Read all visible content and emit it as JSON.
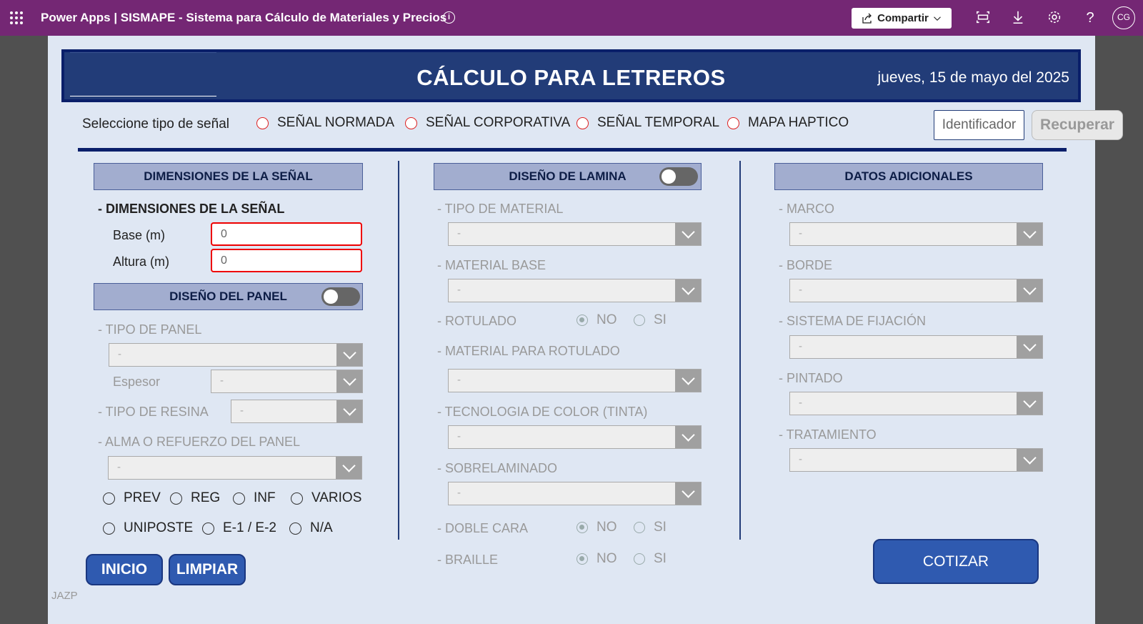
{
  "topbar": {
    "app_title": "Power Apps  |  SISMAPE - Sistema para Cálculo de Materiales y Precios",
    "share_label": "Compartir",
    "avatar_initials": "CG",
    "bg_color": "#742774"
  },
  "header": {
    "title": "CÁLCULO PARA LETREROS",
    "date": "jueves, 15 de mayo del 2025"
  },
  "signal_type": {
    "label": "Seleccione tipo de señal",
    "options": [
      "SEÑAL NORMADA",
      "SEÑAL CORPORATIVA",
      "SEÑAL TEMPORAL",
      "MAPA HAPTICO"
    ]
  },
  "identificador": {
    "placeholder": "Identificador"
  },
  "recuperar_label": "Recuperar",
  "dimensiones": {
    "heading": "DIMENSIONES DE LA SEÑAL",
    "subheading": "- DIMENSIONES DE LA SEÑAL",
    "base_label": "Base (m)",
    "base_value": "0",
    "altura_label": "Altura (m)",
    "altura_value": "0"
  },
  "panel": {
    "heading": "DISEÑO DEL PANEL",
    "tipo_panel": "- TIPO DE PANEL",
    "tipo_panel_value": "-",
    "espesor_label": "Espesor",
    "espesor_value": "-",
    "tipo_resina": "- TIPO DE RESINA",
    "tipo_resina_value": "-",
    "alma": "- ALMA O REFUERZO DEL PANEL",
    "alma_value": "-",
    "radios_row1": [
      "PREV",
      "REG",
      "INF",
      "VARIOS"
    ],
    "radios_row2": [
      "UNIPOSTE",
      "E-1 / E-2",
      "N/A"
    ]
  },
  "lamina": {
    "heading": "DISEÑO DE LAMINA",
    "tipo_material": "- TIPO DE MATERIAL",
    "material_base": "- MATERIAL BASE",
    "rotulado": "- ROTULADO",
    "material_rotulado": "- MATERIAL PARA ROTULADO",
    "tecnologia": "- TECNOLOGIA DE COLOR (TINTA)",
    "sobrelaminado": "- SOBRELAMINADO",
    "doble_cara": "- DOBLE CARA",
    "braille": "- BRAILLE",
    "no": "NO",
    "si": "SI",
    "dd_value": "-"
  },
  "adicionales": {
    "heading": "DATOS ADICIONALES",
    "marco": "- MARCO",
    "borde": "- BORDE",
    "fijacion": "- SISTEMA DE FIJACIÓN",
    "pintado": "- PINTADO",
    "tratamiento": "- TRATAMIENTO",
    "dd_value": "-"
  },
  "buttons": {
    "inicio": "INICIO",
    "limpiar": "LIMPIAR",
    "cotizar": "COTIZAR"
  },
  "credit": "JAZP"
}
